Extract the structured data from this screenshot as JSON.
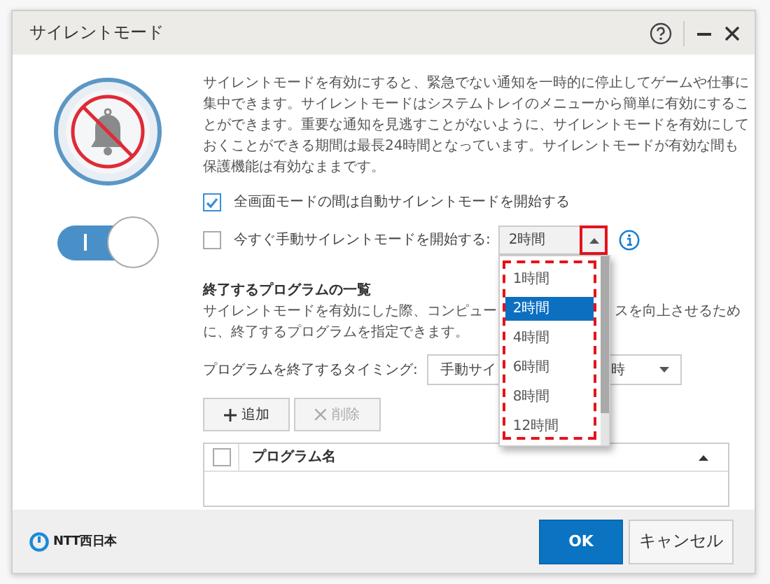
{
  "window": {
    "title": "サイレントモード"
  },
  "silent_toggle": {
    "on": true
  },
  "description": "サイレントモードを有効にすると、緊急でない通知を一時的に停止してゲームや仕事に集中できます。サイレントモードはシステムトレイのメニューから簡単に有効にすることができます。重要な通知を見逃すことがないように、サイレントモードを有効にしておくことができる期間は最長24時間となっています。サイレントモードが有効な間も保護機能は有効なままです。",
  "options": [
    {
      "label": "全画面モードの間は自動サイレントモードを開始する",
      "checked": true
    },
    {
      "label": "今すぐ手動サイレントモードを開始する:",
      "checked": false
    }
  ],
  "duration": {
    "value": "2時間",
    "expanded": true,
    "options": [
      {
        "label": "1時間",
        "selected": false
      },
      {
        "label": "2時間",
        "selected": true
      },
      {
        "label": "4時間",
        "selected": false
      },
      {
        "label": "6時間",
        "selected": false
      },
      {
        "label": "8時間",
        "selected": false
      },
      {
        "label": "12時間",
        "selected": false
      }
    ]
  },
  "program_list": {
    "heading": "終了するプログラムの一覧",
    "description_parts": [
      "サイレントモードを有効にした際、コンピュー",
      "スを向上させるため",
      "に、終了するプログラムを指定できます。"
    ]
  },
  "timing": {
    "label": "プログラムを終了するタイミング:",
    "value_parts": [
      "手動サイ",
      "時"
    ]
  },
  "actions": [
    {
      "label": "追加",
      "kind": "add",
      "disabled": false
    },
    {
      "label": "削除",
      "kind": "delete",
      "disabled": true
    }
  ],
  "table": {
    "select_all_checked": false,
    "columns": [
      "プログラム名"
    ]
  },
  "logo": {
    "text": "NTT西日本"
  },
  "footer_buttons": [
    {
      "label": "OK",
      "kind": "primary"
    },
    {
      "label": "キャンセル",
      "kind": "secondary"
    }
  ]
}
